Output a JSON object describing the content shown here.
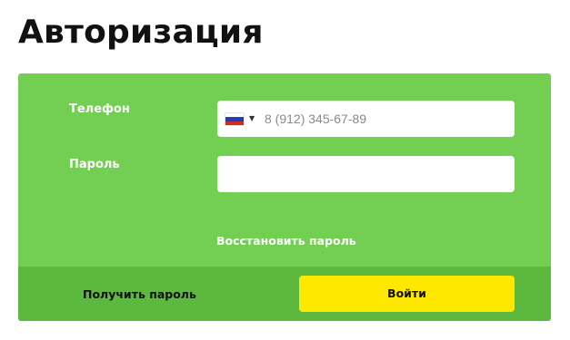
{
  "page": {
    "title": "Авторизация"
  },
  "form": {
    "phone_label": "Телефон",
    "phone_placeholder": "8 (912) 345-67-89",
    "phone_country_icon": "russia-flag-icon",
    "password_label": "Пароль",
    "password_value": "",
    "restore_link": "Восстановить пароль"
  },
  "footer": {
    "get_password_label": "Получить пароль",
    "login_button_label": "Войти"
  },
  "colors": {
    "card_bg": "#72cf51",
    "footer_bg": "#5db93e",
    "button_bg": "#ffe800"
  }
}
